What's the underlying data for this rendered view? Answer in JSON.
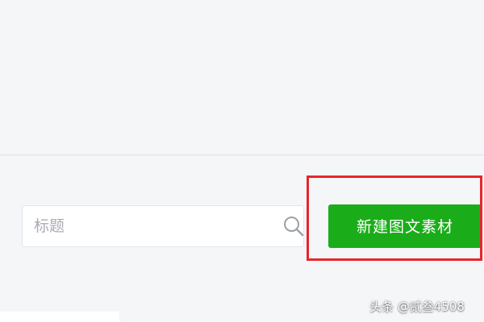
{
  "search": {
    "placeholder": "标题",
    "icon": "search-icon"
  },
  "toolbar": {
    "new_label": "新建图文素材"
  },
  "colors": {
    "accent": "#1aad19",
    "highlight": "#e8262b",
    "background": "#f4f6f8"
  },
  "watermark": {
    "text": "头条 @贰叁4508"
  }
}
